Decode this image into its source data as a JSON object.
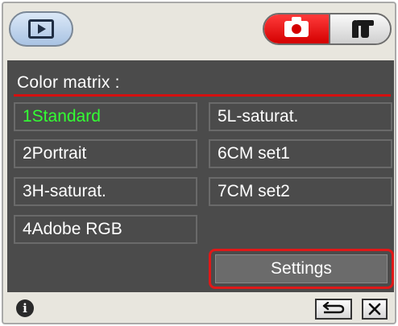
{
  "toolbar": {
    "playback_icon": "playback-icon",
    "camera_icon": "camera-icon",
    "tools_icon": "tools-icon"
  },
  "panel": {
    "title": "Color matrix :",
    "options": [
      {
        "label": "1Standard",
        "selected": true
      },
      {
        "label": "2Portrait",
        "selected": false
      },
      {
        "label": "3H-saturat.",
        "selected": false
      },
      {
        "label": "4Adobe RGB",
        "selected": false
      },
      {
        "label": "5L-saturat.",
        "selected": false
      },
      {
        "label": "6CM set1",
        "selected": false
      },
      {
        "label": "7CM set2",
        "selected": false
      }
    ],
    "settings_label": "Settings"
  },
  "footer": {
    "info_glyph": "i",
    "back_icon": "return-icon",
    "close_icon": "close-icon"
  },
  "colors": {
    "panel_bg": "#4b4b4b",
    "selected_text": "#33ff33",
    "accent_red": "#d41010",
    "frame_bg": "#e8e6de"
  }
}
